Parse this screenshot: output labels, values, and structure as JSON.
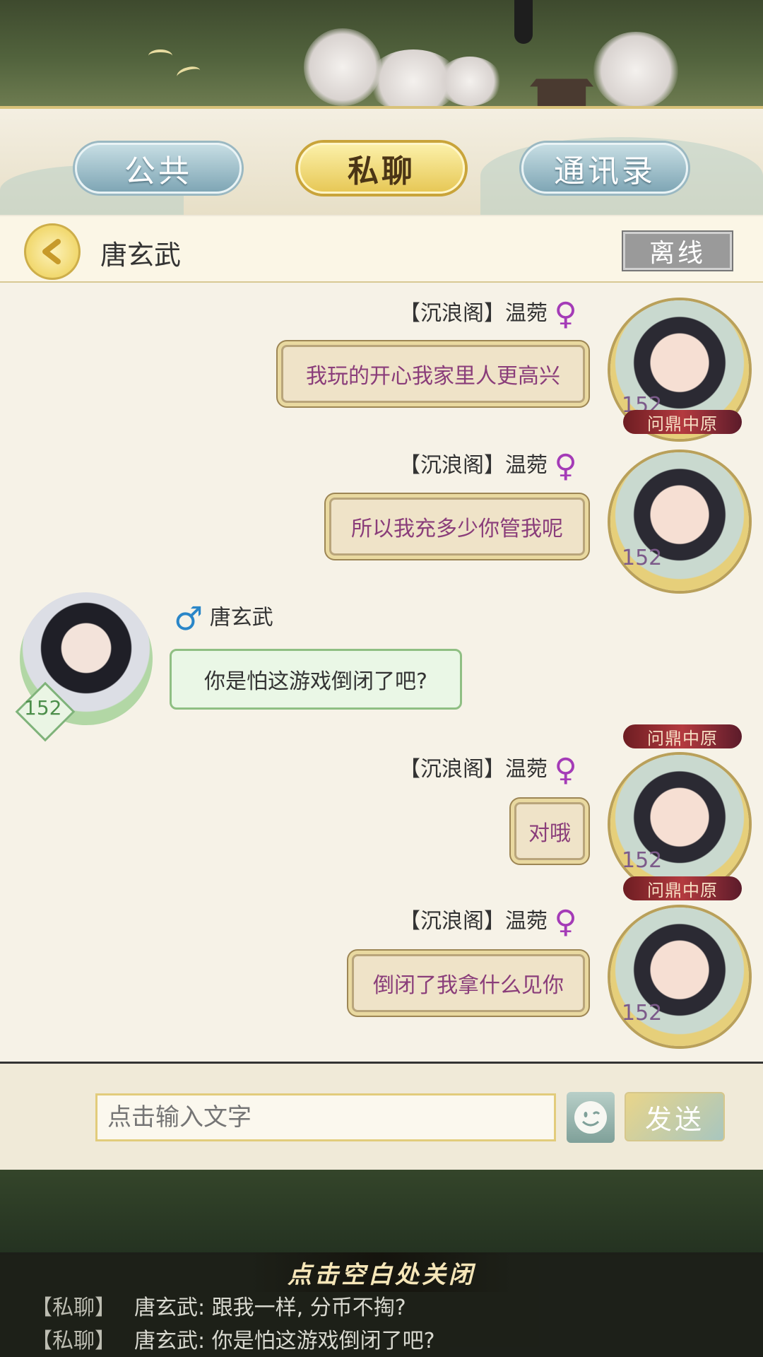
{
  "tabs": [
    {
      "label": "公共",
      "active": false
    },
    {
      "label": "私聊",
      "active": true
    },
    {
      "label": "通讯录",
      "active": false
    }
  ],
  "conversation": {
    "name": "唐玄武",
    "status": "离线"
  },
  "messages": [
    {
      "side": "right",
      "guild": "【沉浪阁】",
      "name": "温菀",
      "gender": "female",
      "text": "我玩的开心我家里人更高兴",
      "level": "152",
      "title": "问鼎中原"
    },
    {
      "side": "right",
      "guild": "【沉浪阁】",
      "name": "温菀",
      "gender": "female",
      "text": "所以我充多少你管我呢",
      "level": "152",
      "title": ""
    },
    {
      "side": "left",
      "guild": "",
      "name": "唐玄武",
      "gender": "male",
      "text": "你是怕这游戏倒闭了吧?",
      "level": "152",
      "title": ""
    },
    {
      "side": "right",
      "guild": "【沉浪阁】",
      "name": "温菀",
      "gender": "female",
      "text": "对哦",
      "level": "152",
      "title": "问鼎中原"
    },
    {
      "side": "right",
      "guild": "【沉浪阁】",
      "name": "温菀",
      "gender": "female",
      "text": "倒闭了我拿什么见你",
      "level": "152",
      "title": "问鼎中原"
    }
  ],
  "composer": {
    "placeholder": "点击输入文字",
    "send_label": "发送"
  },
  "feed": {
    "close_hint": "点击空白处关闭",
    "lines": [
      {
        "tag": "【私聊】",
        "text": "唐玄武: 跟我一样, 分币不掏?"
      },
      {
        "tag": "【私聊】",
        "text": "唐玄武: 你是怕这游戏倒闭了吧?"
      }
    ]
  },
  "icons": {
    "back": "chevron-left-icon",
    "female": "female-symbol-icon",
    "male": "male-symbol-icon",
    "emoji": "smiley-icon"
  },
  "colors": {
    "accent_gold": "#e7c857",
    "tab_blue": "#7fa6b5",
    "message_purple": "#8a3d7a",
    "status_gray": "#9a9a9a"
  }
}
